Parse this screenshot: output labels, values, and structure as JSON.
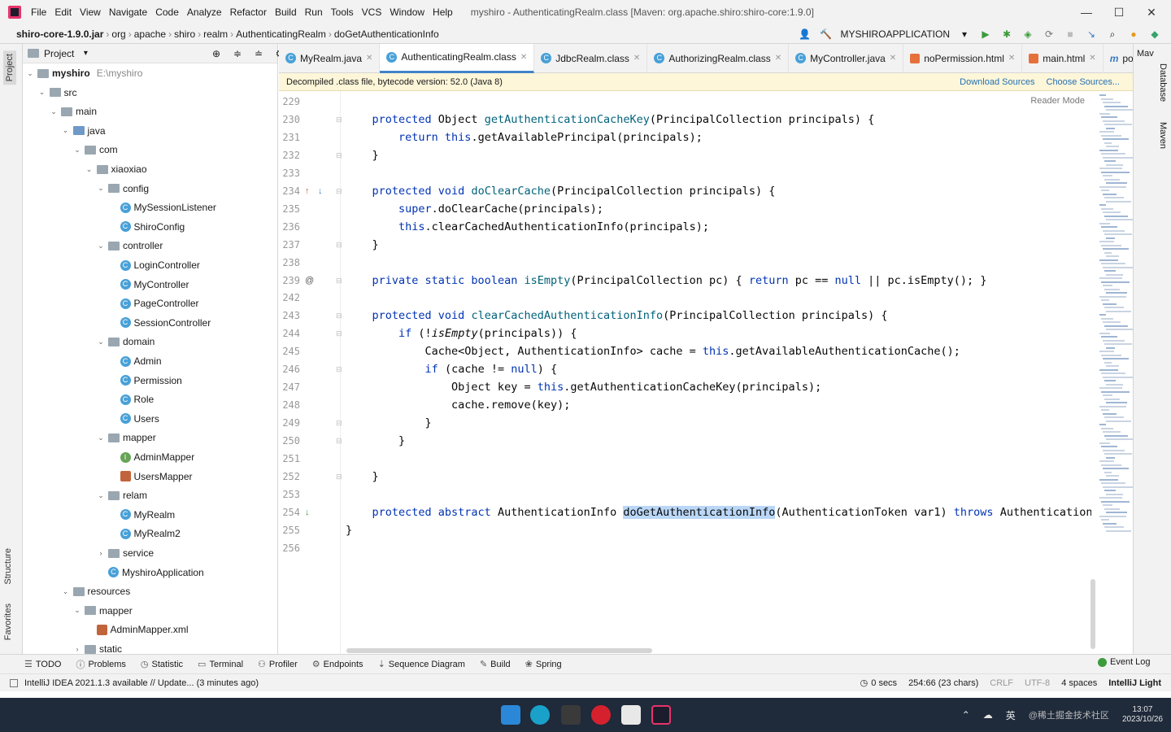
{
  "titlebar": {
    "menus": [
      "File",
      "Edit",
      "View",
      "Navigate",
      "Code",
      "Analyze",
      "Refactor",
      "Build",
      "Run",
      "Tools",
      "VCS",
      "Window",
      "Help"
    ],
    "title": "myshiro - AuthenticatingRealm.class [Maven: org.apache.shiro:shiro-core:1.9.0]"
  },
  "navbar": {
    "crumbs": [
      "shiro-core-1.9.0.jar",
      "org",
      "apache",
      "shiro",
      "realm",
      "AuthenticatingRealm",
      "doGetAuthenticationInfo"
    ],
    "run_config": "MYSHIROAPPLICATION"
  },
  "side_tabs": {
    "project": "Project",
    "structure": "Structure",
    "favorites": "Favorites",
    "database": "Database",
    "maven": "Maven"
  },
  "project": {
    "header": "Project",
    "tree": [
      {
        "label": "myshiro",
        "extra": "E:\\myshiro",
        "depth": 0,
        "arrow": "v",
        "icon": "folder",
        "bold": true
      },
      {
        "label": "src",
        "depth": 1,
        "arrow": "v",
        "icon": "folder"
      },
      {
        "label": "main",
        "depth": 2,
        "arrow": "v",
        "icon": "folder"
      },
      {
        "label": "java",
        "depth": 3,
        "arrow": "v",
        "icon": "src"
      },
      {
        "label": "com",
        "depth": 4,
        "arrow": "v",
        "icon": "pkg"
      },
      {
        "label": "xiaoxiao",
        "depth": 5,
        "arrow": "v",
        "icon": "pkg"
      },
      {
        "label": "config",
        "depth": 6,
        "arrow": "v",
        "icon": "pkg"
      },
      {
        "label": "MySessionListener",
        "depth": 7,
        "arrow": "",
        "icon": "class"
      },
      {
        "label": "ShiroConfig",
        "depth": 7,
        "arrow": "",
        "icon": "class"
      },
      {
        "label": "controller",
        "depth": 6,
        "arrow": "v",
        "icon": "pkg"
      },
      {
        "label": "LoginController",
        "depth": 7,
        "arrow": "",
        "icon": "class"
      },
      {
        "label": "MyController",
        "depth": 7,
        "arrow": "",
        "icon": "class"
      },
      {
        "label": "PageController",
        "depth": 7,
        "arrow": "",
        "icon": "class"
      },
      {
        "label": "SessionController",
        "depth": 7,
        "arrow": "",
        "icon": "class"
      },
      {
        "label": "domain",
        "depth": 6,
        "arrow": "v",
        "icon": "pkg"
      },
      {
        "label": "Admin",
        "depth": 7,
        "arrow": "",
        "icon": "class"
      },
      {
        "label": "Permission",
        "depth": 7,
        "arrow": "",
        "icon": "class"
      },
      {
        "label": "Role",
        "depth": 7,
        "arrow": "",
        "icon": "class"
      },
      {
        "label": "Users",
        "depth": 7,
        "arrow": "",
        "icon": "class"
      },
      {
        "label": "mapper",
        "depth": 6,
        "arrow": "v",
        "icon": "pkg"
      },
      {
        "label": "AdminMapper",
        "depth": 7,
        "arrow": "",
        "icon": "interface"
      },
      {
        "label": "UsersMapper",
        "depth": 7,
        "arrow": "",
        "icon": "mybatis"
      },
      {
        "label": "relam",
        "depth": 6,
        "arrow": "v",
        "icon": "pkg"
      },
      {
        "label": "MyRealm",
        "depth": 7,
        "arrow": "",
        "icon": "class"
      },
      {
        "label": "MyRealm2",
        "depth": 7,
        "arrow": "",
        "icon": "class"
      },
      {
        "label": "service",
        "depth": 6,
        "arrow": ">",
        "icon": "pkg"
      },
      {
        "label": "MyshiroApplication",
        "depth": 6,
        "arrow": "",
        "icon": "class"
      },
      {
        "label": "resources",
        "depth": 3,
        "arrow": "v",
        "icon": "folder"
      },
      {
        "label": "mapper",
        "depth": 4,
        "arrow": "v",
        "icon": "folder"
      },
      {
        "label": "AdminMapper.xml",
        "depth": 5,
        "arrow": "",
        "icon": "mybatis"
      },
      {
        "label": "static",
        "depth": 4,
        "arrow": ">",
        "icon": "folder"
      }
    ]
  },
  "tabs": [
    {
      "label": "MyRealm.java",
      "active": false
    },
    {
      "label": "AuthenticatingRealm.class",
      "active": true
    },
    {
      "label": "JdbcRealm.class",
      "active": false
    },
    {
      "label": "AuthorizingRealm.class",
      "active": false
    },
    {
      "label": "MyController.java",
      "active": false
    },
    {
      "label": "noPermission.html",
      "active": false
    },
    {
      "label": "main.html",
      "active": false
    },
    {
      "label": "pom.xml (myshiro)",
      "active": false
    }
  ],
  "notice": {
    "text": "Decompiled .class file, bytecode version: 52.0 (Java 8)",
    "download": "Download Sources",
    "choose": "Choose Sources..."
  },
  "reader_mode": "Reader Mode",
  "code_lines": [
    {
      "n": "229",
      "t": []
    },
    {
      "n": "230",
      "t": [
        [
          "    ",
          ""
        ],
        [
          "protected ",
          "kw"
        ],
        [
          "Object ",
          ""
        ],
        [
          "getAuthenticationCacheKey",
          "fn"
        ],
        [
          "(PrincipalCollection principals) {",
          ""
        ]
      ]
    },
    {
      "n": "231",
      "t": [
        [
          "        ",
          ""
        ],
        [
          "return this",
          "kw"
        ],
        [
          ".getAvailablePrincipal(principals);",
          ""
        ]
      ]
    },
    {
      "n": "232",
      "t": [
        [
          "    }",
          ""
        ]
      ]
    },
    {
      "n": "233",
      "t": []
    },
    {
      "n": "234",
      "t": [
        [
          "    ",
          ""
        ],
        [
          "protected void ",
          "kw"
        ],
        [
          "doClearCache",
          "fn"
        ],
        [
          "(PrincipalCollection principals) {",
          ""
        ]
      ]
    },
    {
      "n": "235",
      "t": [
        [
          "        ",
          ""
        ],
        [
          "super",
          "kw"
        ],
        [
          ".doClearCache(principals);",
          ""
        ]
      ]
    },
    {
      "n": "236",
      "t": [
        [
          "        ",
          ""
        ],
        [
          "this",
          "kw"
        ],
        [
          ".clearCachedAuthenticationInfo(principals);",
          ""
        ]
      ]
    },
    {
      "n": "237",
      "t": [
        [
          "    }",
          ""
        ]
      ]
    },
    {
      "n": "238",
      "t": []
    },
    {
      "n": "239",
      "t": [
        [
          "    ",
          ""
        ],
        [
          "private static boolean ",
          "kw"
        ],
        [
          "isEmpty",
          "fn"
        ],
        [
          "(PrincipalCollection pc) { ",
          ""
        ],
        [
          "return ",
          "kw"
        ],
        [
          "pc == ",
          ""
        ],
        [
          "null",
          "kw"
        ],
        [
          " || pc.isEmpty(); }",
          ""
        ]
      ]
    },
    {
      "n": "242",
      "t": []
    },
    {
      "n": "243",
      "t": [
        [
          "    ",
          ""
        ],
        [
          "protected void ",
          "kw"
        ],
        [
          "clearCachedAuthenticationInfo",
          "fn"
        ],
        [
          "(PrincipalCollection principals) {",
          ""
        ]
      ]
    },
    {
      "n": "244",
      "t": [
        [
          "        ",
          ""
        ],
        [
          "if ",
          "kw"
        ],
        [
          "(!",
          ""
        ],
        [
          "isEmpty",
          "it"
        ],
        [
          "(principals)) {",
          ""
        ]
      ]
    },
    {
      "n": "245",
      "t": [
        [
          "            Cache<Object, AuthenticationInfo> cache = ",
          ""
        ],
        [
          "this",
          "kw"
        ],
        [
          ".getAvailableAuthenticationCache();",
          ""
        ]
      ]
    },
    {
      "n": "246",
      "t": [
        [
          "            ",
          ""
        ],
        [
          "if ",
          "kw"
        ],
        [
          "(cache != ",
          ""
        ],
        [
          "null",
          "kw"
        ],
        [
          ") {",
          ""
        ]
      ]
    },
    {
      "n": "247",
      "t": [
        [
          "                Object key = ",
          ""
        ],
        [
          "this",
          "kw"
        ],
        [
          ".getAuthenticationCacheKey(principals);",
          ""
        ]
      ]
    },
    {
      "n": "248",
      "t": [
        [
          "                cache.remove(key);",
          ""
        ]
      ]
    },
    {
      "n": "249",
      "t": [
        [
          "            }",
          ""
        ]
      ]
    },
    {
      "n": "250",
      "t": [
        [
          "        }",
          ""
        ]
      ]
    },
    {
      "n": "251",
      "t": []
    },
    {
      "n": "252",
      "t": [
        [
          "    }",
          ""
        ]
      ]
    },
    {
      "n": "253",
      "t": []
    },
    {
      "n": "254",
      "t": [
        [
          "    ",
          ""
        ],
        [
          "protected abstract ",
          "kw"
        ],
        [
          "AuthenticationInfo ",
          ""
        ],
        [
          "doGetAuthenticationInfo",
          "hl"
        ],
        [
          "(AuthenticationToken var1) ",
          ""
        ],
        [
          "throws ",
          "kw"
        ],
        [
          "AuthenticationExce",
          ""
        ]
      ]
    },
    {
      "n": "255",
      "t": [
        [
          "}",
          ""
        ]
      ]
    },
    {
      "n": "256",
      "t": []
    }
  ],
  "bottom_tools": [
    "TODO",
    "Problems",
    "Statistic",
    "Terminal",
    "Profiler",
    "Endpoints",
    "Sequence Diagram",
    "Build",
    "Spring"
  ],
  "event_log": "Event Log",
  "status": {
    "message": "IntelliJ IDEA 2021.1.3 available // Update... (3 minutes ago)",
    "timer": "0 secs",
    "position": "254:66 (23 chars)",
    "line_sep": "CRLF",
    "encoding": "UTF-8",
    "indent": "4 spaces",
    "theme": "IntelliJ Light"
  },
  "taskbar": {
    "ime": "英",
    "time": "13:07",
    "date": "2023/10/26",
    "watermark": "@稀土掘金技术社区"
  },
  "right_panel": {
    "maven_short": "Mav"
  }
}
